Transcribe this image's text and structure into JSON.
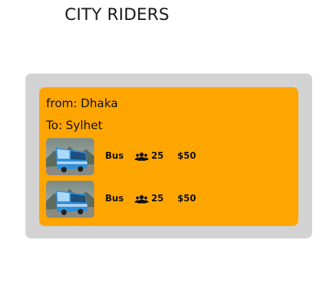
{
  "brand": {
    "title": "CITY RIDERS"
  },
  "route": {
    "from_label": "from:",
    "from_value": "Dhaka",
    "to_label": "To:",
    "to_value": "Sylhet"
  },
  "rides": [
    {
      "type": "Bus",
      "seats": "25",
      "price": "$50",
      "icon": "users-icon"
    },
    {
      "type": "Bus",
      "seats": "25",
      "price": "$50",
      "icon": "users-icon"
    }
  ],
  "colors": {
    "card": "#ffa500",
    "panel": "#d3d3d3",
    "text": "#111111"
  }
}
